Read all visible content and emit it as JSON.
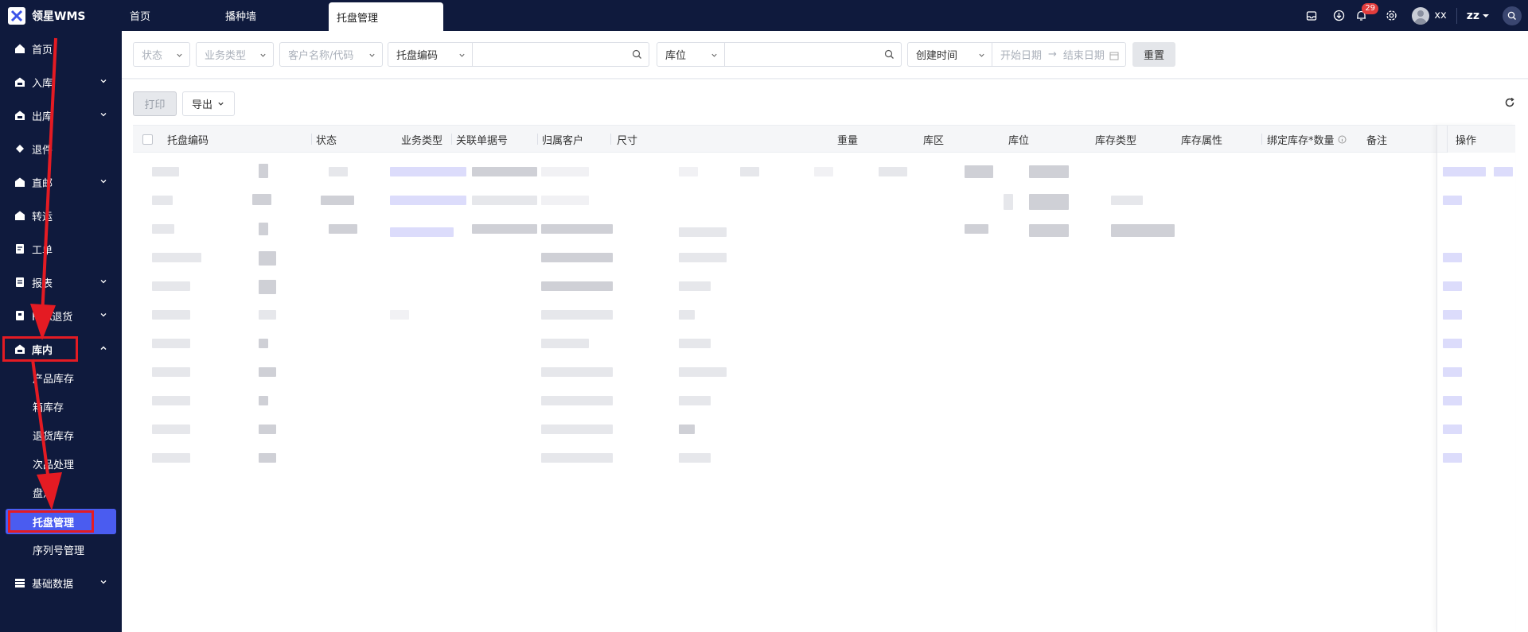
{
  "app": {
    "logo_text": "领星WMS"
  },
  "tabs": [
    {
      "label": "首页"
    },
    {
      "label": "播种墙"
    },
    {
      "label": "托盘管理",
      "active": true
    }
  ],
  "header": {
    "notification_count": "29",
    "user_short": "xx",
    "user_name": "zz"
  },
  "sidebar": {
    "items": [
      {
        "label": "首页",
        "icon": "home-icon"
      },
      {
        "label": "入库",
        "icon": "inbound-icon"
      },
      {
        "label": "出库",
        "icon": "outbound-icon"
      },
      {
        "label": "退件",
        "icon": "return-icon"
      },
      {
        "label": "直邮",
        "icon": "direct-mail-icon"
      },
      {
        "label": "转运",
        "icon": "transfer-icon"
      },
      {
        "label": "工单",
        "icon": "workorder-icon"
      },
      {
        "label": "报表",
        "icon": "report-icon"
      },
      {
        "label": "FBA退货",
        "icon": "fba-return-icon"
      },
      {
        "label": "库内",
        "icon": "warehouse-icon"
      },
      {
        "label": "基础数据",
        "icon": "base-data-icon"
      }
    ],
    "sub_items": [
      {
        "label": "产品库存"
      },
      {
        "label": "箱库存"
      },
      {
        "label": "退货库存"
      },
      {
        "label": "次品处理"
      },
      {
        "label": "盘点"
      },
      {
        "label": "托盘管理",
        "active": true
      },
      {
        "label": "序列号管理"
      }
    ]
  },
  "filters": {
    "status_placeholder": "状态",
    "biz_type_placeholder": "业务类型",
    "customer_placeholder": "客户名称/代码",
    "pallet_select": "托盘编码",
    "location_select": "库位",
    "time_select": "创建时间",
    "start_date": "开始日期",
    "date_arrow": "→",
    "end_date": "结束日期",
    "reset_label": "重置"
  },
  "toolbar": {
    "print_label": "打印",
    "export_label": "导出"
  },
  "table": {
    "columns": [
      {
        "label": "托盘编码"
      },
      {
        "label": "状态"
      },
      {
        "label": "业务类型"
      },
      {
        "label": "关联单据号"
      },
      {
        "label": "归属客户"
      },
      {
        "label": "尺寸"
      },
      {
        "label": "重量"
      },
      {
        "label": "库区"
      },
      {
        "label": "库位"
      },
      {
        "label": "库存类型"
      },
      {
        "label": "库存属性"
      },
      {
        "label": "绑定库存*数量"
      },
      {
        "label": "备注"
      },
      {
        "label": "操作"
      }
    ]
  },
  "colors": {
    "sidebar_bg": "#0f1a3d",
    "accent": "#4a5cf0",
    "highlight_red": "#e41b23"
  }
}
